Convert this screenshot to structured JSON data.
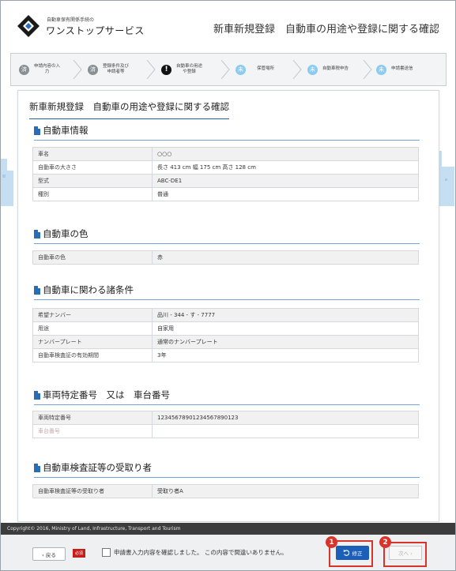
{
  "header": {
    "logo_small": "自動車保有関係手続の",
    "logo_big": "ワンストップサービス",
    "page_heading": "新車新規登録　自動車の用途や登録に関する確認"
  },
  "steps": [
    {
      "icon_text": "済",
      "label": "申請内容の入\n力",
      "state": "done"
    },
    {
      "icon_text": "済",
      "label": "登録条件及び\n申請者等",
      "state": "done"
    },
    {
      "icon_text": "!",
      "label": "自動車の用途\nや登録",
      "state": "current"
    },
    {
      "icon_text": "未",
      "label": "保管場所",
      "state": "todo"
    },
    {
      "icon_text": "未",
      "label": "自動車税申告",
      "state": "todo"
    },
    {
      "icon_text": "未",
      "label": "申請書送信",
      "state": "todo"
    }
  ],
  "panel": {
    "title": "新車新規登録　自動車の用途や登録に関する確認",
    "sections": [
      {
        "heading": "自動車情報",
        "rows": [
          {
            "k": "車名",
            "v": "○○○"
          },
          {
            "k": "自動車の大きさ",
            "v": "長さ 413 cm  幅 175 cm  高さ 128 cm"
          },
          {
            "k": "型式",
            "v": "ABC-DE1"
          },
          {
            "k": "種別",
            "v": "普通"
          }
        ]
      },
      {
        "heading": "自動車の色",
        "rows": [
          {
            "k": "自動車の色",
            "v": "赤"
          }
        ]
      },
      {
        "heading": "自動車に関わる諸条件",
        "rows": [
          {
            "k": "希望ナンバー",
            "v": "品川 - 344 - す - 7777"
          },
          {
            "k": "用途",
            "v": "自家用"
          },
          {
            "k": "ナンバープレート",
            "v": "通常のナンバープレート"
          },
          {
            "k": "自動車検査証の有効期間",
            "v": "3年"
          }
        ]
      },
      {
        "heading": "車両特定番号　又は　車台番号",
        "rows": [
          {
            "k": "車両特定番号",
            "v": "12345678901234567890123"
          },
          {
            "k": "車台番号",
            "v": ""
          }
        ]
      },
      {
        "heading": "自動車検査証等の受取り者",
        "rows": [
          {
            "k": "自動車検査証等の受取り者",
            "v": "受取り者A"
          }
        ]
      }
    ]
  },
  "footer": {
    "copyright": "Copyright© 2016, Ministry of Land, Infrastructure, Transport and Tourism"
  },
  "actions": {
    "back_label": "‹ 戻る",
    "required_badge": "必須",
    "confirm_text": "申請書入力内容を確認しました。 この内容で間違いありません。",
    "fix_label": "修正",
    "next_label": "次へ ›",
    "callout_1": "1",
    "callout_2": "2"
  },
  "colors": {
    "accent": "#1b5fb9",
    "callout": "#d9342b",
    "footer_bg": "#3d3d3d"
  }
}
